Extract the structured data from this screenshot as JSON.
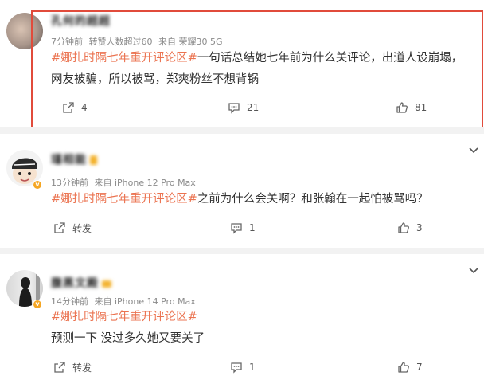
{
  "posts": [
    {
      "username": "孔何的超超",
      "time": "7分钟前",
      "extra": "转赞人数超过60",
      "source": "来自 荣耀30 5G",
      "tag": "#娜扎时隔七年重开评论区#",
      "text": "一句话总结她七年前为什么关评论，出道人设崩塌，网友被骗，所以被骂，郑爽粉丝不想背锅",
      "forward": "4",
      "comments": "21",
      "likes": "81"
    },
    {
      "username": "瑾相能",
      "time": "13分钟前",
      "source": "来自 iPhone 12 Pro Max",
      "tag": "#娜扎时隔七年重开评论区#",
      "text": "之前为什么会关啊？和张翰在一起怕被骂吗？",
      "forward": "转发",
      "comments": "1",
      "likes": "3"
    },
    {
      "username": "腹黑文殿",
      "time": "14分钟前",
      "source": "来自 iPhone 14 Pro Max",
      "tag": "#娜扎时隔七年重开评论区#",
      "text": "预测一下 没过多久她又要关了",
      "forward": "转发",
      "comments": "1",
      "likes": "7"
    }
  ],
  "colors": {
    "accent": "#eb7350",
    "highlight_border": "#e14b3b",
    "meta": "#8a8a8a"
  },
  "icons": {
    "forward": "share-icon",
    "comment": "comment-icon",
    "like": "thumbs-up-icon",
    "more": "chevron-down-icon"
  }
}
